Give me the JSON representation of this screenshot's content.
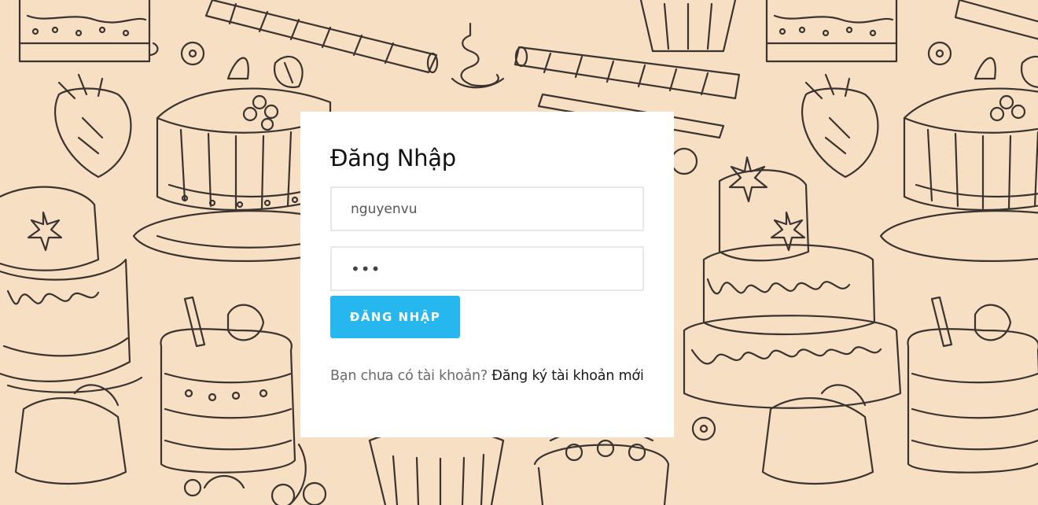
{
  "login": {
    "title": "Đăng Nhập",
    "username_value": "nguyenvu",
    "password_value": "•••",
    "submit_label": "ĐĂNG NHẬP",
    "register_prompt": "Bạn chưa có tài khoản?",
    "register_link": "Đăng ký tài khoản mới"
  },
  "colors": {
    "background": "#f6dfc3",
    "line_art": "#3a3330",
    "card": "#ffffff",
    "button": "#27b7ef"
  },
  "icons": {
    "background_pattern": "cake-doodle-pattern"
  }
}
